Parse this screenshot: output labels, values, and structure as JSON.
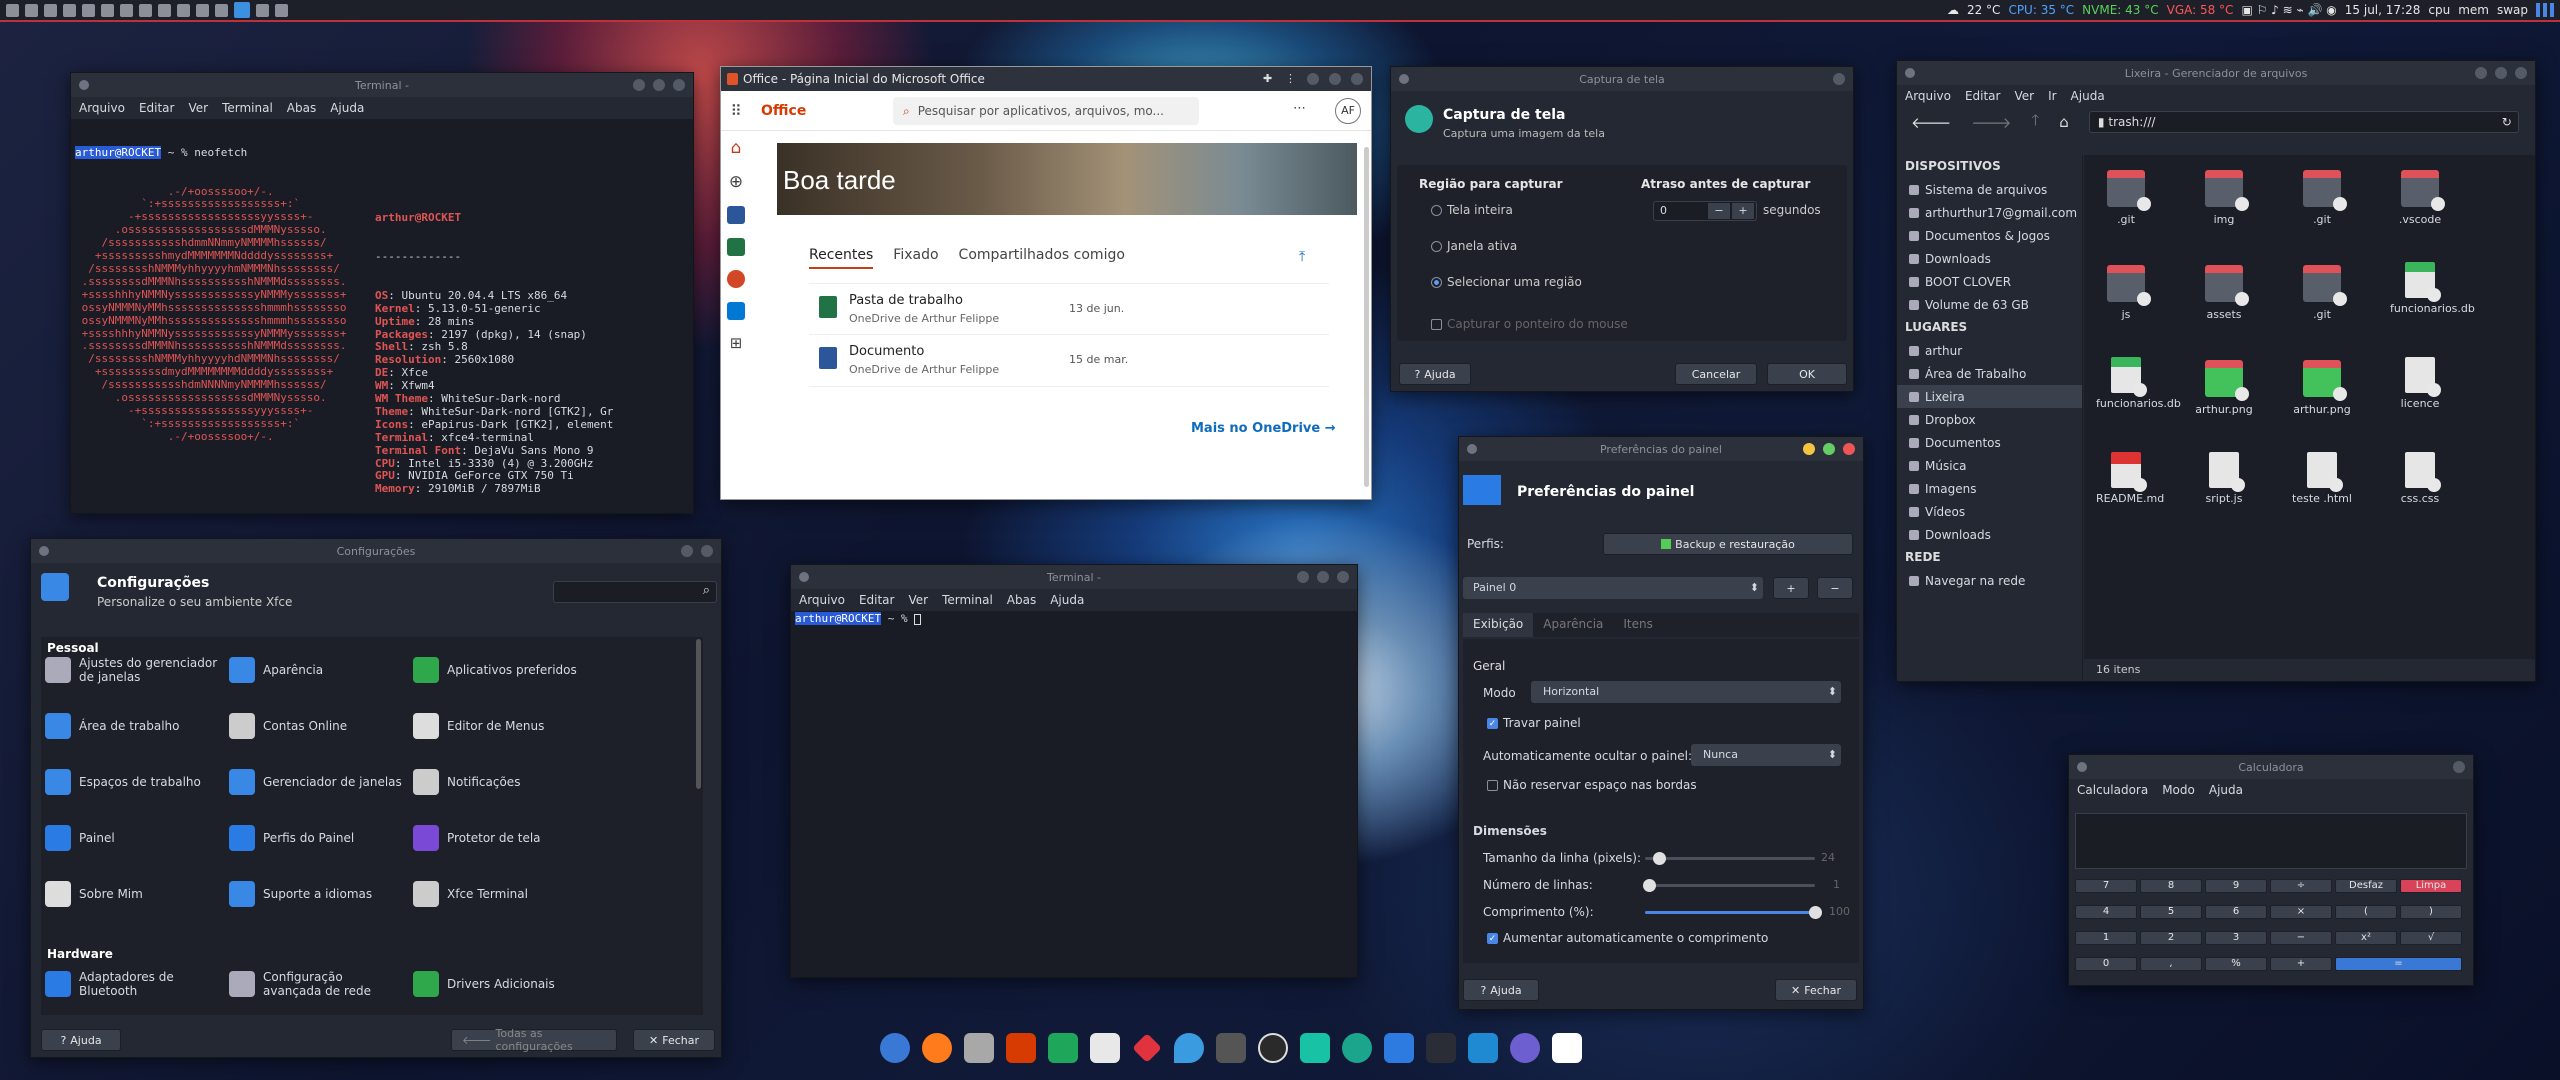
{
  "topbar": {
    "temp": "22 °C",
    "cpu": "CPU: 35 °C",
    "nvme": "NVME: 43 °C",
    "vga": "VGA: 58 °C",
    "datetime": "15 jul, 17:28",
    "cpu_label": "cpu",
    "mem_label": "mem",
    "swap_label": "swap"
  },
  "term1": {
    "title": "Terminal -",
    "menu": [
      "Arquivo",
      "Editar",
      "Ver",
      "Terminal",
      "Abas",
      "Ajuda"
    ],
    "prompt": "arthur@ROCKET",
    "cmd": " ~ % neofetch",
    "logo": [
      "              .-/+oossssoo+/-.",
      "          `:+ssssssssssssssssss+:`",
      "        -+ssssssssssssssssssyyssss+-",
      "      .ossssssssssssssssssdMMMNysssso.",
      "    /ssssssssssshdmmNNmmyNMMMMhssssss/",
      "   +ssssssssshmydMMMMMMMNddddyssssssss+",
      "  /sssssssshNMMMyhhyyyyhmNMMMNhssssssss/",
      " .ssssssssdMMMNhsssssssssshNMMMdssssssss.",
      " +sssshhhyNMMNyssssssssssssyNMMMysssssss+",
      " ossyNMMMNyMMhsssssssssssssshmmmhssssssso",
      " ossyNMMMNyMMhsssssssssssssshmmmhssssssso",
      " +sssshhhyNMMNyssssssssssssyNMMMysssssss+",
      " .ssssssssdMMMNhsssssssssshNMMMdssssssss.",
      "  /sssssssshNMMMyhhyyyyhdNMMMNhssssssss/",
      "   +sssssssssdmydMMMMMMMMddddyssssssss+",
      "    /ssssssssssshdmNNNNmyNMMMMhssssss/",
      "      .ossssssssssssssssssdMMMNysssso.",
      "        -+sssssssssssssssssyyyssss+-",
      "          `:+ssssssssssssssssss+:`",
      "              .-/+oossssoo+/-."
    ],
    "user": "arthur@ROCKET",
    "sep": "-------------",
    "info": [
      [
        "OS",
        "Ubuntu 20.04.4 LTS x86_64"
      ],
      [
        "Kernel",
        "5.13.0-51-generic"
      ],
      [
        "Uptime",
        "28 mins"
      ],
      [
        "Packages",
        "2197 (dpkg), 14 (snap)"
      ],
      [
        "Shell",
        "zsh 5.8"
      ],
      [
        "Resolution",
        "2560x1080"
      ],
      [
        "DE",
        "Xfce"
      ],
      [
        "WM",
        "Xfwm4"
      ],
      [
        "WM Theme",
        "WhiteSur-Dark-nord"
      ],
      [
        "Theme",
        "WhiteSur-Dark-nord [GTK2], Gr"
      ],
      [
        "Icons",
        "ePapirus-Dark [GTK2], element"
      ],
      [
        "Terminal",
        "xfce4-terminal"
      ],
      [
        "Terminal Font",
        "DejaVu Sans Mono 9"
      ],
      [
        "CPU",
        "Intel i5-3330 (4) @ 3.200GHz"
      ],
      [
        "GPU",
        "NVIDIA GeForce GTX 750 Ti"
      ],
      [
        "Memory",
        "2910MiB / 7897MiB"
      ]
    ],
    "prompt2": " ~ % "
  },
  "office": {
    "title": "Office - Página Inicial do Microsoft Office",
    "brand": "Office",
    "search": "Pesquisar por aplicativos, arquivos, mo...",
    "avatar": "AF",
    "greeting": "Boa tarde",
    "tabs": [
      "Recentes",
      "Fixado",
      "Compartilhados comigo"
    ],
    "files": [
      {
        "name": "Pasta de trabalho",
        "loc": "OneDrive de Arthur Felippe",
        "date": "13 de jun."
      },
      {
        "name": "Documento",
        "loc": "OneDrive de Arthur Felippe",
        "date": "15 de mar."
      }
    ],
    "more": "Mais no OneDrive →"
  },
  "capture": {
    "title": "Captura de tela",
    "header": "Captura de tela",
    "sub": "Captura uma imagem da tela",
    "region_label": "Região para capturar",
    "opts": [
      "Tela inteira",
      "Janela ativa",
      "Selecionar uma região"
    ],
    "delay_label": "Atraso antes de capturar",
    "delay": "0",
    "units": "segundos",
    "pointer": "Capturar o ponteiro do mouse",
    "help": "Ajuda",
    "cancel": "Cancelar",
    "ok": "OK"
  },
  "files": {
    "title": "Lixeira - Gerenciador de arquivos",
    "menu": [
      "Arquivo",
      "Editar",
      "Ver",
      "Ir",
      "Ajuda"
    ],
    "path": "trash:///",
    "dev_head": "DISPOSITIVOS",
    "devices": [
      "Sistema de arquivos",
      "arthurthur17@gmail.com",
      "Documentos & Jogos",
      "Downloads",
      "BOOT CLOVER",
      "Volume de 63 GB"
    ],
    "places_head": "LUGARES",
    "places": [
      "arthur",
      "Área de Trabalho",
      "Lixeira",
      "Dropbox",
      "Documentos",
      "Música",
      "Imagens",
      "Vídeos",
      "Downloads"
    ],
    "net_head": "REDE",
    "network": [
      "Navegar na rede"
    ],
    "items": [
      ".git",
      "img",
      ".git",
      ".vscode",
      "js",
      "assets",
      ".git",
      "funcionarios.db",
      "funcionarios.db",
      "arthur.png",
      "arthur.png",
      "licence",
      "README.md",
      "sript.js",
      "teste .html",
      "css.css"
    ],
    "status": "16 itens"
  },
  "settings": {
    "title": "Configurações",
    "header": "Configurações",
    "sub": "Personalize o seu ambiente Xfce",
    "sec1": "Pessoal",
    "sec2": "Hardware",
    "items": [
      "Ajustes do gerenciador de janelas",
      "Aparência",
      "Aplicativos preferidos",
      "Área de trabalho",
      "Contas Online",
      "Editor de Menus",
      "Espaços de trabalho",
      "Gerenciador de janelas",
      "Notificações",
      "Painel",
      "Perfis do Painel",
      "Protetor de tela",
      "Sobre Mim",
      "Suporte a idiomas",
      "Xfce Terminal"
    ],
    "hw": [
      "Adaptadores de Bluetooth",
      "Configuração avançada de rede",
      "Drivers Adicionais"
    ],
    "help": "Ajuda",
    "all": "Todas as configurações",
    "close": "Fechar"
  },
  "term2": {
    "title": "Terminal -",
    "menu": [
      "Arquivo",
      "Editar",
      "Ver",
      "Terminal",
      "Abas",
      "Ajuda"
    ],
    "prompt": "arthur@ROCKET",
    "cmd": " ~ % "
  },
  "panel": {
    "title": "Preferências do painel",
    "header": "Preferências do painel",
    "profiles": "Perfis:",
    "backup": "Backup e restauração",
    "panel": "Painel 0",
    "tabs": [
      "Exibição",
      "Aparência",
      "Itens"
    ],
    "geral": "Geral",
    "mode_label": "Modo",
    "mode": "Horizontal",
    "lock": "Travar painel",
    "autohide_label": "Automaticamente ocultar o painel:",
    "autohide": "Nunca",
    "reserve": "Não reservar espaço nas bordas",
    "dims": "Dimensões",
    "row_size": "Tamanho da linha (pixels):",
    "row_size_val": "24",
    "rows": "Número de linhas:",
    "rows_val": "1",
    "length": "Comprimento (%):",
    "length_val": "100",
    "autolen": "Aumentar automaticamente o comprimento",
    "help": "Ajuda",
    "close": "Fechar"
  },
  "calc": {
    "title": "Calculadora",
    "menu": [
      "Calculadora",
      "Modo",
      "Ajuda"
    ],
    "keys": [
      [
        "7",
        "8",
        "9",
        "÷",
        "Desfaz",
        "Limpa"
      ],
      [
        "4",
        "5",
        "6",
        "×",
        "(",
        ")"
      ],
      [
        "1",
        "2",
        "3",
        "−",
        "x²",
        "√"
      ],
      [
        "0",
        ",",
        "%",
        "+",
        "="
      ]
    ]
  }
}
